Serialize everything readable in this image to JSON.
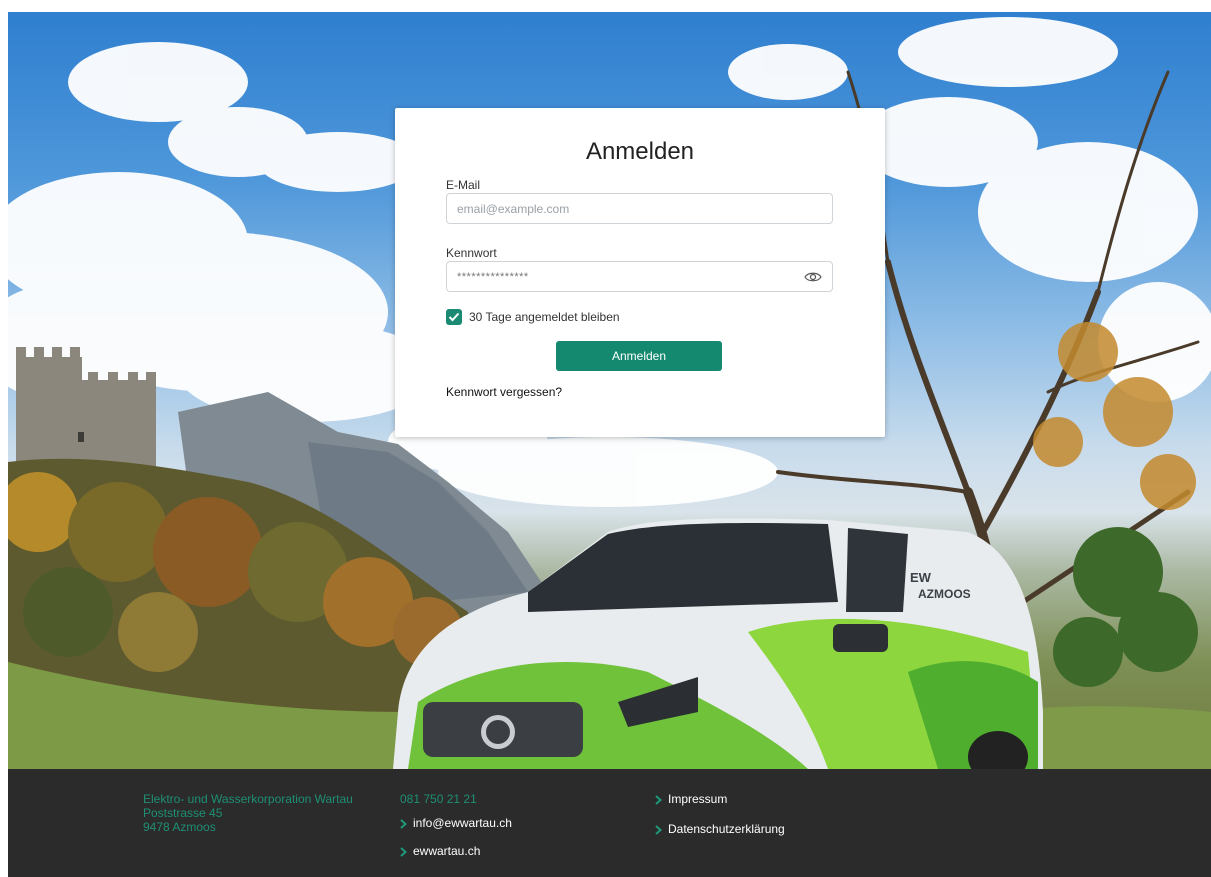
{
  "login": {
    "title": "Anmelden",
    "email_label": "E-Mail",
    "email_placeholder": "email@example.com",
    "password_label": "Kennwort",
    "password_value": "***************",
    "remember_label": "30 Tage angemeldet bleiben",
    "remember_checked": true,
    "submit_label": "Anmelden",
    "forgot_label": "Kennwort vergessen?"
  },
  "footer": {
    "address": [
      "Elektro- und Wasserkorporation Wartau",
      "Poststrasse 45",
      "9478 Azmoos"
    ],
    "phone": "081 750 21 21",
    "email_link": "info@ewwartau.ch",
    "website_link": "ewwartau.ch",
    "impressum_link": "Impressum",
    "privacy_link": "Datenschutzerklärung"
  },
  "van_text": [
    "EW",
    "AZMOOS"
  ],
  "colors": {
    "accent": "#15896f",
    "footer_bg": "#2b2b2b",
    "footer_text": "#1e8f73"
  }
}
